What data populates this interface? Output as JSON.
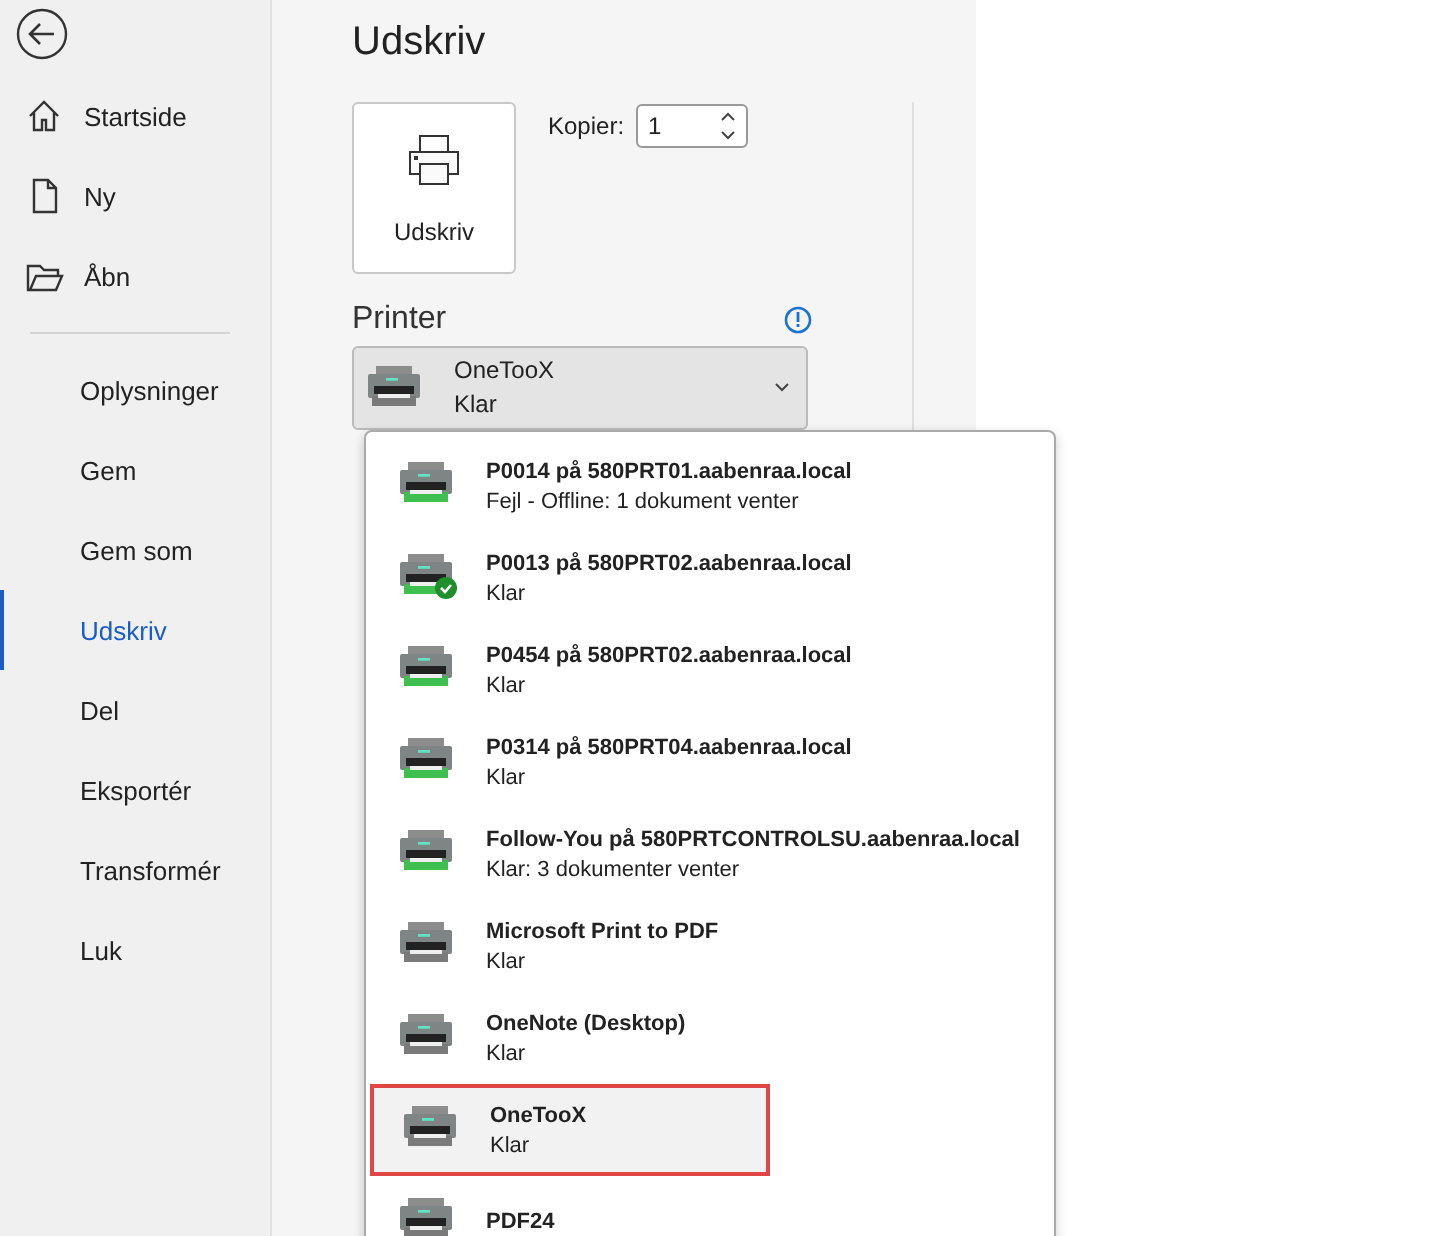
{
  "sidebar": {
    "items": [
      {
        "label": "Startside",
        "kind": "home",
        "selected": false
      },
      {
        "label": "Ny",
        "kind": "document",
        "selected": false
      },
      {
        "label": "Åbn",
        "kind": "folder",
        "selected": false
      },
      {
        "label": "Oplysninger",
        "selected": false
      },
      {
        "label": "Gem",
        "selected": false
      },
      {
        "label": "Gem som",
        "selected": false
      },
      {
        "label": "Udskriv",
        "selected": true
      },
      {
        "label": "Del",
        "selected": false
      },
      {
        "label": "Eksportér",
        "selected": false
      },
      {
        "label": "Transformér",
        "selected": false
      },
      {
        "label": "Luk",
        "selected": false
      }
    ]
  },
  "title": "Udskriv",
  "print_button": {
    "label": "Udskriv"
  },
  "copies": {
    "label": "Kopier:",
    "value": "1"
  },
  "printer": {
    "heading": "Printer",
    "name": "OneTooX",
    "status": "Klar",
    "expanded": true
  },
  "printer_list": [
    {
      "name": "P0014 på 580PRT01.aabenraa.local",
      "status": "Fejl - Offline: 1 dokument venter",
      "kind": "network",
      "default": false,
      "selected": false,
      "highlighted": false
    },
    {
      "name": "P0013 på 580PRT02.aabenraa.local",
      "status": "Klar",
      "kind": "network",
      "default": true,
      "selected": false,
      "highlighted": false
    },
    {
      "name": "P0454 på 580PRT02.aabenraa.local",
      "status": "Klar",
      "kind": "network",
      "default": false,
      "selected": false,
      "highlighted": false
    },
    {
      "name": "P0314 på 580PRT04.aabenraa.local",
      "status": "Klar",
      "kind": "network",
      "default": false,
      "selected": false,
      "highlighted": false
    },
    {
      "name": "Follow-You på 580PRTCONTROLSU.aabenraa.local",
      "status": "Klar: 3 dokumenter venter",
      "kind": "network",
      "default": false,
      "selected": false,
      "highlighted": false
    },
    {
      "name": "Microsoft Print to PDF",
      "status": "Klar",
      "kind": "local",
      "default": false,
      "selected": false,
      "highlighted": false
    },
    {
      "name": "OneNote (Desktop)",
      "status": "Klar",
      "kind": "local",
      "default": false,
      "selected": false,
      "highlighted": false
    },
    {
      "name": "OneTooX",
      "status": "Klar",
      "kind": "local",
      "default": false,
      "selected": true,
      "highlighted": true
    },
    {
      "name": "PDF24",
      "kind": "local",
      "default": false,
      "selected": false,
      "highlighted": false
    }
  ]
}
